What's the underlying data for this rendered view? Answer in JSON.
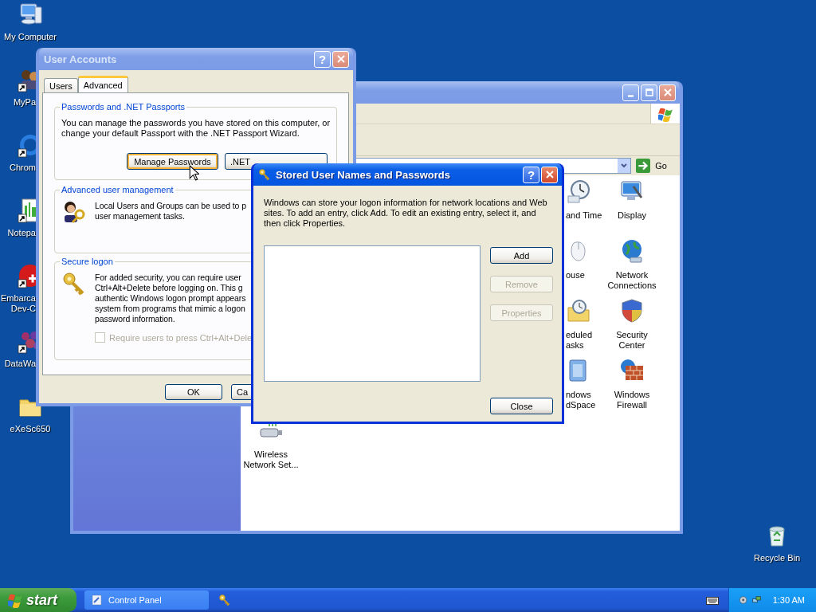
{
  "desktop_icons": [
    {
      "label": "My Computer",
      "kind": "computer",
      "shortcut": false,
      "cut": false
    },
    {
      "label": "MyPa",
      "kind": "people",
      "shortcut": true,
      "cut": true
    },
    {
      "label": "Chrom",
      "kind": "ring",
      "shortcut": true,
      "cut": true
    },
    {
      "label": "Notepa",
      "kind": "notepad",
      "shortcut": true,
      "cut": true
    },
    {
      "label": "Embarca Dev-C",
      "kind": "badge",
      "shortcut": true,
      "cut": true
    },
    {
      "label": "DataWa",
      "kind": "dots",
      "shortcut": true,
      "cut": true
    },
    {
      "label": "eXeSc650",
      "kind": "folder",
      "shortcut": false,
      "cut": false
    }
  ],
  "recycle_bin": {
    "label": "Recycle Bin"
  },
  "control_panel": {
    "address_bar": {
      "go_label": "Go"
    },
    "icons": [
      {
        "label": "and Time",
        "kind": "clock"
      },
      {
        "label": "Display",
        "kind": "display"
      },
      {
        "label": "ouse",
        "kind": "mouse"
      },
      {
        "label": "Network Connections",
        "kind": "network"
      },
      {
        "label": "eduled asks",
        "kind": "scheduled"
      },
      {
        "label": "Security Center",
        "kind": "shield"
      },
      {
        "label": "ndows dSpace",
        "kind": "card"
      },
      {
        "label": "Windows Firewall",
        "kind": "firewall"
      },
      {
        "label": "Wireless Network Set...",
        "kind": "wireless"
      }
    ]
  },
  "user_accounts": {
    "title": "User Accounts",
    "help_label": "?",
    "tabs": [
      {
        "label": "Users",
        "selected": false
      },
      {
        "label": "Advanced",
        "selected": true
      }
    ],
    "groups": [
      {
        "title": "Passwords and .NET Passports",
        "kind": "none",
        "text_lines": [
          "You can manage the passwords you have stored on this computer, or",
          "change your default Passport with the .NET Passport Wizard."
        ],
        "buttons": [
          {
            "label": "Manage Passwords",
            "focused": true
          },
          {
            "label": ".NET",
            "focused": false
          }
        ]
      },
      {
        "title": "Advanced user management",
        "kind": "users",
        "text_lines": [
          "Local Users and Groups can be used to p",
          "user management tasks."
        ]
      },
      {
        "title": "Secure logon",
        "kind": "key",
        "text_lines": [
          "For added security, you can require user",
          "Ctrl+Alt+Delete before logging on. This g",
          "authentic Windows logon prompt appears",
          "system from programs that mimic a logon",
          "password information."
        ],
        "checkbox": {
          "label": "Require users to press Ctrl+Alt+Dele",
          "checked": false,
          "disabled": true
        }
      }
    ],
    "buttons": [
      {
        "label": "OK"
      },
      {
        "label": "Ca"
      }
    ]
  },
  "stored_dialog": {
    "title": "Stored User Names and Passwords",
    "help_label": "?",
    "text": "Windows can store your logon information for network locations and Web sites. To add an entry, click Add. To edit an existing entry, select it, and then click Properties.",
    "buttons": [
      {
        "label": "Add",
        "disabled": false
      },
      {
        "label": "Remove",
        "disabled": true
      },
      {
        "label": "Properties",
        "disabled": true
      }
    ],
    "close_button": {
      "label": "Close"
    }
  },
  "taskbar": {
    "start_label": "start",
    "tasks": [
      {
        "label": "Control Panel",
        "kind": "control-panel"
      },
      {
        "kind": "key"
      }
    ],
    "clock": "1:30 AM"
  }
}
